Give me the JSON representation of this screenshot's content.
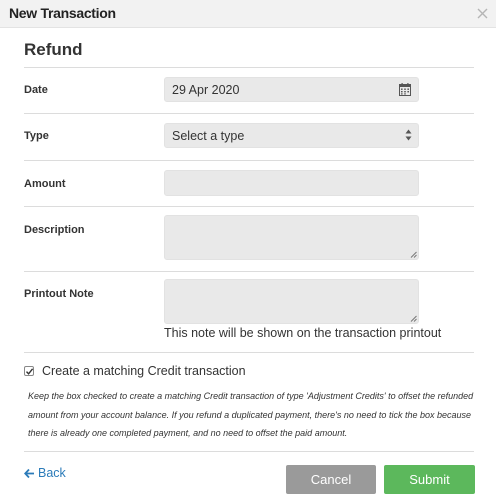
{
  "dialog": {
    "title": "New Transaction"
  },
  "section": {
    "title": "Refund"
  },
  "form": {
    "date": {
      "label": "Date",
      "value": "29 Apr 2020"
    },
    "type": {
      "label": "Type",
      "value": "Select a type"
    },
    "amount": {
      "label": "Amount",
      "value": ""
    },
    "description": {
      "label": "Description",
      "value": ""
    },
    "printout_note": {
      "label": "Printout Note",
      "value": "",
      "hint": "This note will be shown on the transaction printout"
    }
  },
  "credit": {
    "checked": true,
    "label": "Create a matching Credit transaction",
    "note": "Keep the box checked to create a matching Credit transaction of type 'Adjustment Credits' to offset the refunded amount from your account balance. If you refund a duplicated payment, there's no need to tick the box because there is already one completed payment, and no need to offset the paid amount."
  },
  "footer": {
    "back_label": "Back",
    "cancel_label": "Cancel",
    "submit_label": "Submit"
  },
  "colors": {
    "link": "#2b7bb9",
    "submit": "#5cb85c",
    "cancel": "#9a9a9a"
  }
}
